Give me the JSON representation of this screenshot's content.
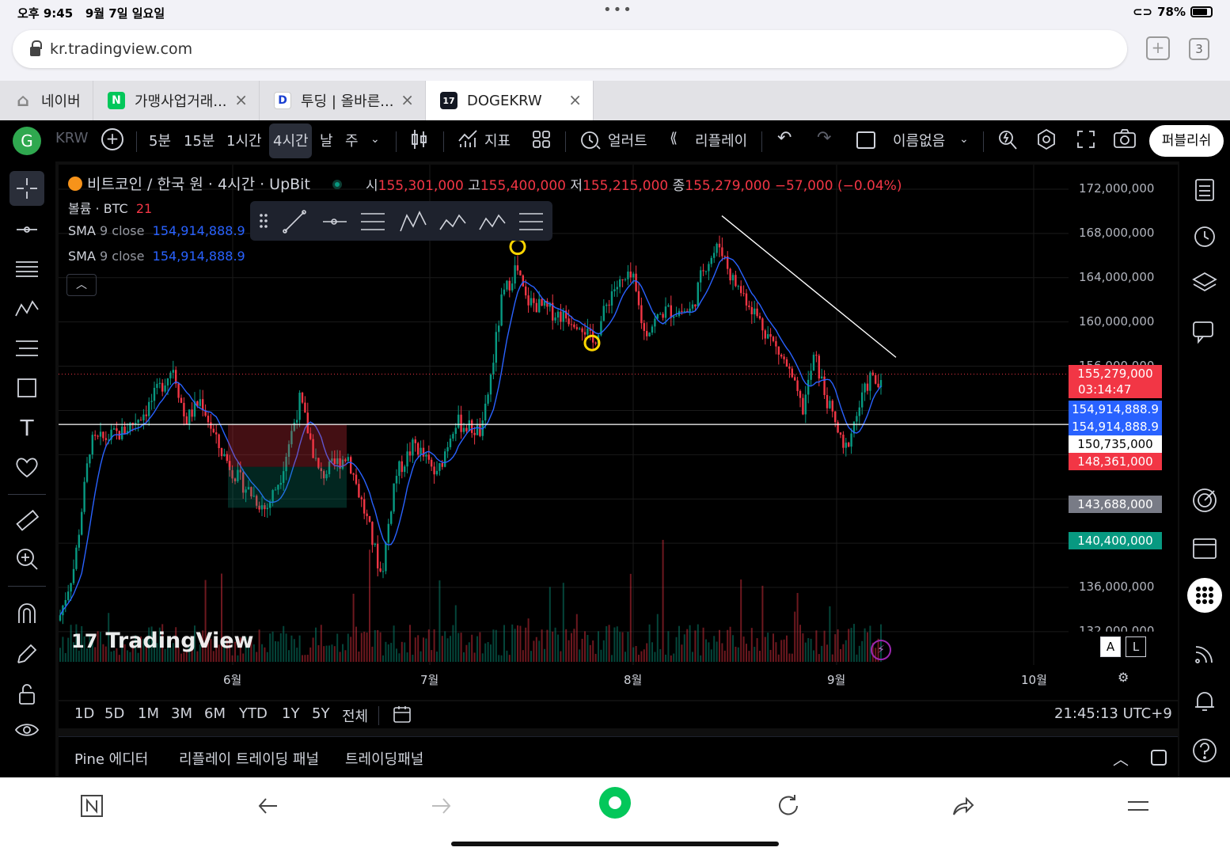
{
  "status": {
    "time": "오후 9:45",
    "date": "9월 7일 일요일",
    "battery": "78%"
  },
  "browser": {
    "url": "kr.tradingview.com",
    "tab_count": "3",
    "tabs": [
      {
        "title": "네이버",
        "icon": "home-icon"
      },
      {
        "title": "가맹사업거래...",
        "icon": "naver-n-icon"
      },
      {
        "title": "투딩 | 올바른...",
        "icon": "tooding-icon"
      },
      {
        "title": "DOGEKRW",
        "icon": "tradingview-icon"
      }
    ]
  },
  "toolbar": {
    "avatar": "G",
    "symbol": "KRW",
    "timeframes": [
      "5분",
      "15분",
      "1시간",
      "4시간",
      "날",
      "주"
    ],
    "active_timeframe": "4시간",
    "indicators_label": "지표",
    "alert_label": "얼러트",
    "replay_label": "리플레이",
    "layout_name": "이름없음",
    "publish_label": "퍼블리쉬"
  },
  "chart": {
    "title": "비트코인 / 한국 원 · 4시간 · UpBit",
    "ohlc": {
      "o_label": "시",
      "o": "155,301,000",
      "h_label": "고",
      "h": "155,400,000",
      "l_label": "저",
      "l": "155,215,000",
      "c_label": "종",
      "c": "155,279,000",
      "change": "−57,000 (−0.04%)"
    },
    "volume_label": "볼륨 · BTC",
    "volume_value": "21",
    "sma": [
      {
        "label": "SMA",
        "param": "9 close",
        "value": "154,914,888.9"
      },
      {
        "label": "SMA",
        "param": "9 close",
        "value": "154,914,888.9"
      }
    ],
    "price_axis": [
      "172,000,000",
      "168,000,000",
      "164,000,000",
      "160,000,000",
      "156,000,000",
      "136,000,000",
      "132,000,000"
    ],
    "price_labels": [
      {
        "text": "155,279,000",
        "sub": "03:14:47",
        "color": "#f23645"
      },
      {
        "text": "154,914,888.9",
        "color": "#2962ff"
      },
      {
        "text": "154,914,888.9",
        "color": "#2962ff"
      },
      {
        "text": "150,735,000",
        "color": "#ffffff"
      },
      {
        "text": "148,361,000",
        "color": "#f23645"
      },
      {
        "text": "143,688,000",
        "color": "#787b86"
      },
      {
        "text": "140,400,000",
        "color": "#089981"
      }
    ],
    "months": [
      "6월",
      "7월",
      "8월",
      "9월",
      "10월"
    ],
    "watermark": "TradingView",
    "scale_a": "A",
    "scale_l": "L"
  },
  "range_bar": {
    "ranges": [
      "1D",
      "5D",
      "1M",
      "3M",
      "6M",
      "YTD",
      "1Y",
      "5Y",
      "전체"
    ],
    "clock": "21:45:13 UTC+9"
  },
  "bottom_panel": {
    "tabs": [
      "Pine 에디터",
      "리플레이 트레이딩 패널",
      "트레이딩패널"
    ]
  },
  "colors": {
    "up": "#089981",
    "down": "#f23645",
    "sma": "#2962ff",
    "bg": "#000000"
  }
}
